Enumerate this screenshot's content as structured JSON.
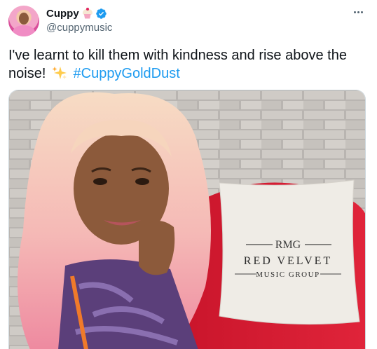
{
  "tweet": {
    "author": {
      "display_name": "Cuppy",
      "handle": "@cuppymusic",
      "name_emoji": "cupcake-icon",
      "verified": true
    },
    "text_plain": "I've learnt to kill them with kindness and rise above the noise!",
    "emoji": "sparkles-icon",
    "hashtag": "#CuppyGoldDust",
    "colors": {
      "link": "#1d9bf0",
      "text": "#0f1419",
      "secondary": "#536471",
      "verified": "#1d9bf0"
    }
  },
  "media": {
    "pillow_logo": "RMG",
    "pillow_line1": "RED VELVET",
    "pillow_line2": "MUSIC GROUP"
  }
}
